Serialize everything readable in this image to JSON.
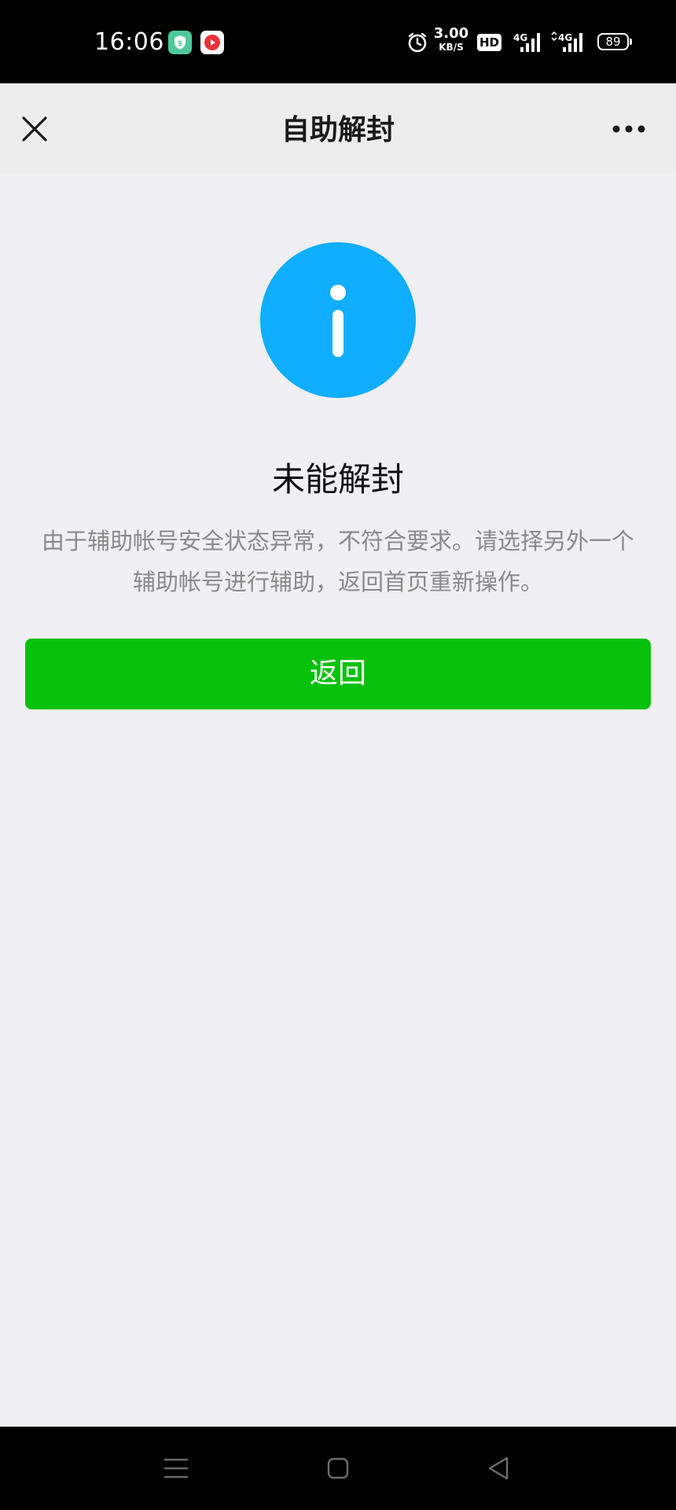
{
  "status_bar": {
    "time": "16:06",
    "network_speed_value": "3.00",
    "network_speed_unit": "KB/S",
    "hd_badge": "HD",
    "signal_1_label": "4G",
    "signal_2_label": "4G",
    "battery_level": "89",
    "icons": [
      "shield-app-icon",
      "video-app-icon",
      "alarm-icon",
      "hd-icon",
      "signal-icon",
      "signal-icon",
      "battery-icon"
    ]
  },
  "header": {
    "title": "自助解封",
    "close_icon": "close-icon",
    "more_icon": "more-icon"
  },
  "result": {
    "icon": "info-icon",
    "icon_color": "#10aeff",
    "title": "未能解封",
    "description": "由于辅助帐号安全状态异常，不符合要求。请选择另外一个辅助帐号进行辅助，返回首页重新操作。"
  },
  "actions": {
    "return_label": "返回",
    "return_color": "#07c10a"
  },
  "system_nav": {
    "icons": [
      "menu-icon",
      "home-icon",
      "back-icon"
    ]
  }
}
